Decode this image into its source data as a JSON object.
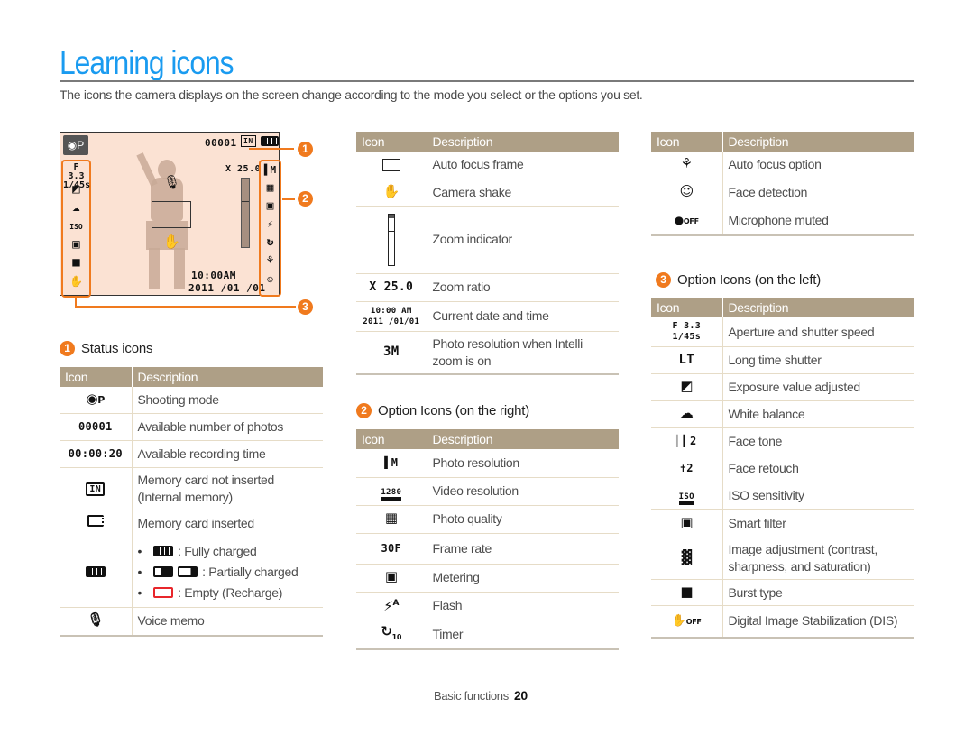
{
  "page": {
    "title": "Learning icons",
    "intro": "The icons the camera displays on the screen change according to the mode you select or the options you set.",
    "accent_color": "#1a9bf0",
    "badge_color": "#f07a1e",
    "table_header_color": "#ae9f86"
  },
  "screen": {
    "mode_icon": "camera-program-icon",
    "photo_count": "00001",
    "memory_icon": "internal-memory-icon",
    "battery_icon": "battery-full-icon",
    "zoom_ratio": "X 25.0",
    "time": "10:00AM",
    "date": "2011 /01 /01",
    "aperture": "F 3.3",
    "shutter": "1/45s",
    "callouts": [
      "1",
      "2",
      "3"
    ],
    "left_icons": [
      "aperture-shutter-icon",
      "exposure-icon",
      "white-balance-icon",
      "iso-icon",
      "smart-filter-icon",
      "burst-icon",
      "dis-off-icon"
    ],
    "right_icons": [
      "photo-resolution-icon",
      "photo-quality-icon",
      "metering-icon",
      "flash-auto-icon",
      "timer-icon",
      "macro-icon",
      "face-detection-icon"
    ]
  },
  "status": {
    "badge": "1",
    "heading": "Status icons",
    "col_icon": "Icon",
    "col_desc": "Description",
    "rows": [
      {
        "icon": "camera-program-icon",
        "glyph": "◙P",
        "desc": "Shooting mode"
      },
      {
        "icon": "photo-count-icon",
        "glyph": "00001",
        "desc": "Available number of photos"
      },
      {
        "icon": "recording-time-icon",
        "glyph": "00:00:20",
        "desc": "Available recording time"
      },
      {
        "icon": "internal-memory-icon",
        "glyph": "IN▸",
        "desc": "Memory card not inserted (Internal memory)"
      },
      {
        "icon": "memory-card-icon",
        "glyph": "▭▸",
        "desc": "Memory card inserted"
      },
      {
        "icon": "battery-icon",
        "glyph": "",
        "desc": "",
        "bullets": [
          ": Fully charged",
          ": Partially charged",
          ": Empty (Recharge)"
        ]
      },
      {
        "icon": "microphone-icon",
        "glyph": "🎙",
        "desc": "Voice memo"
      }
    ]
  },
  "general": {
    "col_icon": "Icon",
    "col_desc": "Description",
    "rows": [
      {
        "icon": "af-frame-icon",
        "glyph": "",
        "desc": "Auto focus frame"
      },
      {
        "icon": "camera-shake-icon",
        "glyph": "✋",
        "desc": "Camera shake"
      },
      {
        "icon": "zoom-indicator-icon",
        "glyph": "",
        "desc": "Zoom indicator"
      },
      {
        "icon": "zoom-ratio-icon",
        "glyph": "X 25.0",
        "desc": "Zoom ratio"
      },
      {
        "icon": "date-time-icon",
        "glyph": "10:00 AM",
        "glyph2": "2011 /01/01",
        "desc": "Current date and time"
      },
      {
        "icon": "intelli-zoom-resolution-icon",
        "glyph": "3M",
        "desc": "Photo resolution when Intelli zoom is on"
      }
    ]
  },
  "right": {
    "badge": "2",
    "heading": "Option Icons (on the right)",
    "col_icon": "Icon",
    "col_desc": "Description",
    "rows": [
      {
        "icon": "photo-resolution-icon",
        "glyph": "▌M",
        "desc": "Photo resolution"
      },
      {
        "icon": "video-resolution-icon",
        "glyph": "1280",
        "desc": "Video resolution"
      },
      {
        "icon": "photo-quality-icon",
        "glyph": "▦F",
        "desc": "Photo quality"
      },
      {
        "icon": "frame-rate-icon",
        "glyph": "30F",
        "desc": "Frame rate"
      },
      {
        "icon": "metering-icon",
        "glyph": "▣",
        "desc": "Metering"
      },
      {
        "icon": "flash-auto-icon",
        "glyph": "⚡A",
        "desc": "Flash"
      },
      {
        "icon": "timer-icon",
        "glyph": "↻10",
        "desc": "Timer"
      }
    ]
  },
  "focus": {
    "col_icon": "Icon",
    "col_desc": "Description",
    "rows": [
      {
        "icon": "macro-icon",
        "glyph": "⚘",
        "desc": "Auto focus option"
      },
      {
        "icon": "face-detection-icon",
        "glyph": "[☺]",
        "desc": "Face detection"
      },
      {
        "icon": "microphone-muted-icon",
        "glyph": "●OFF",
        "desc": "Microphone muted"
      }
    ]
  },
  "left": {
    "badge": "3",
    "heading": "Option Icons (on the left)",
    "col_icon": "Icon",
    "col_desc": "Description",
    "rows": [
      {
        "icon": "aperture-shutter-icon",
        "glyph": "F 3.3",
        "glyph2": "1/45s",
        "desc": "Aperture and shutter speed"
      },
      {
        "icon": "long-time-shutter-icon",
        "glyph": "LT",
        "desc": "Long time shutter"
      },
      {
        "icon": "exposure-icon",
        "glyph": "◩",
        "desc": "Exposure value adjusted"
      },
      {
        "icon": "white-balance-icon",
        "glyph": "☁",
        "desc": "White balance"
      },
      {
        "icon": "face-tone-icon",
        "glyph": "▎2",
        "desc": "Face tone"
      },
      {
        "icon": "face-retouch-icon",
        "glyph": "✔2",
        "desc": "Face retouch"
      },
      {
        "icon": "iso-icon",
        "glyph": "ISO",
        "desc": "ISO sensitivity"
      },
      {
        "icon": "smart-filter-icon",
        "glyph": "▣",
        "desc": "Smart filter"
      },
      {
        "icon": "image-adjustment-icon",
        "glyph": "▓",
        "desc": "Image adjustment (contrast, sharpness, and saturation)"
      },
      {
        "icon": "burst-icon",
        "glyph": "■",
        "desc": "Burst type"
      },
      {
        "icon": "dis-off-icon",
        "glyph": "✋OFF",
        "desc": "Digital Image Stabilization (DIS)"
      }
    ]
  },
  "footer": {
    "section": "Basic functions",
    "page_number": "20"
  }
}
